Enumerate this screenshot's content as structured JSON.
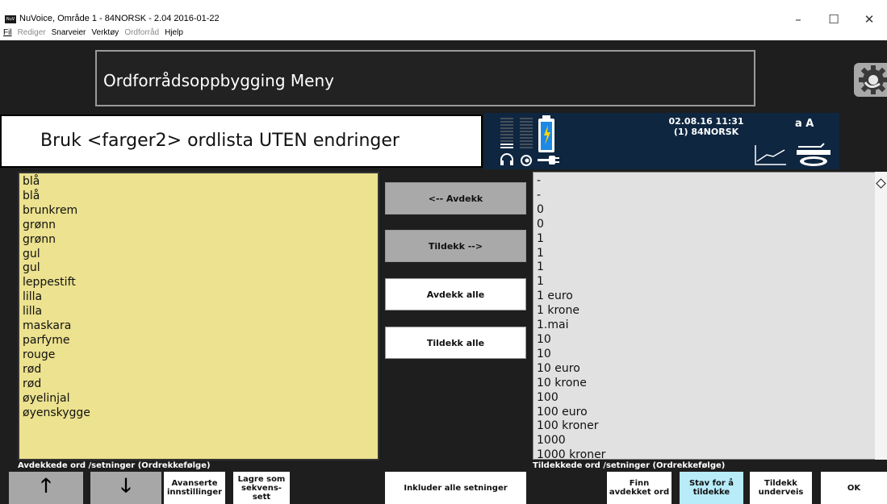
{
  "window": {
    "title": "NuVoice, Område 1 - 84NORSK - 2.04 2016-01-22",
    "controls": [
      "–",
      "☐",
      "✕"
    ]
  },
  "menu": [
    {
      "label": "Fil",
      "disabled": false
    },
    {
      "label": "Rediger",
      "disabled": true
    },
    {
      "label": "Snarveier",
      "disabled": false
    },
    {
      "label": "Verktøy",
      "disabled": false
    },
    {
      "label": "Ordforråd",
      "disabled": true
    },
    {
      "label": "Hjelp",
      "disabled": false
    }
  ],
  "header": {
    "title": "Ordforrådsoppbygging Meny",
    "instruction": "Bruk <farger2> ordlista UTEN endringer"
  },
  "status": {
    "datetime": "02.08.16 11:31",
    "profile": "(1) 84NORSK",
    "text_size": "a A",
    "battery_color": "#1e88e5"
  },
  "left_list": {
    "items": [
      "blå",
      "blå",
      "brunkrem",
      "grønn",
      "grønn",
      "gul",
      "gul",
      "leppestift",
      "lilla",
      "lilla",
      "maskara",
      "parfyme",
      "rouge",
      "rød",
      "rød",
      "øyelinjal",
      "øyenskygge"
    ]
  },
  "right_list": {
    "items": [
      "-",
      "-",
      "0",
      "0",
      "1",
      "1",
      "1",
      "1",
      "1 euro",
      "1 krone",
      "1.mai",
      "10",
      "10",
      "10 euro",
      "10 krone",
      "100",
      "100 euro",
      "100 kroner",
      "1000",
      "1000 kroner"
    ]
  },
  "middle_buttons": {
    "reveal": "<-- Avdekk",
    "cover": "Tildekk -->",
    "reveal_all": "Avdekk alle",
    "cover_all": "Tildekk alle"
  },
  "bottom": {
    "left_label": "Avdekkede ord /setninger (Ordrekkefølge)",
    "right_label": "Tildekkede ord /setninger (Ordrekkefølge)",
    "up_arrow": "🡑",
    "down_arrow": "🡓",
    "advanced_line1": "Avanserte",
    "advanced_line2": "innstillinger",
    "save_line1": "Lagre som",
    "save_line2": "sekvens-sett",
    "include_all": "Inkluder alle setninger",
    "find_line1": "Finn",
    "find_line2": "avdekket ord",
    "spell_line1": "Stav for å",
    "spell_line2": "tildekke",
    "cover_line1": "Tildekk",
    "cover_line2": "underveis",
    "ok": "OK"
  }
}
